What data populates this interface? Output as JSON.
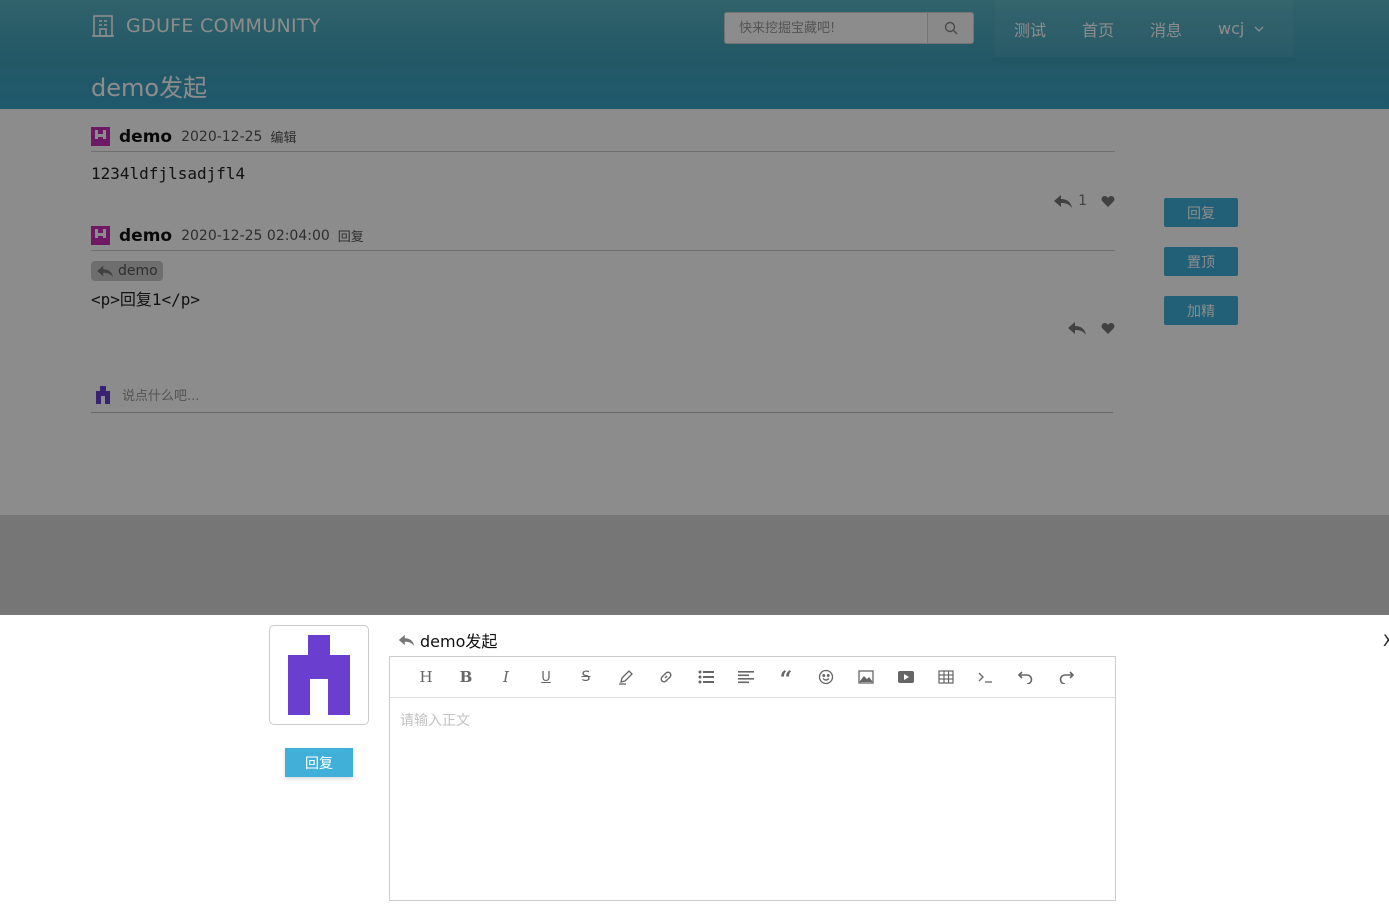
{
  "header": {
    "brand": "GDUFE COMMUNITY",
    "search_placeholder": "快来挖掘宝藏吧!",
    "nav": [
      "测试",
      "首页",
      "消息"
    ],
    "user": "wcj",
    "page_title": "demo发起"
  },
  "posts": [
    {
      "author": "demo",
      "date": "2020-12-25",
      "action": "编辑",
      "body": "1234ldfjlsadjfl4",
      "reply_count": "1"
    },
    {
      "author": "demo",
      "date": "2020-12-25 02:04:00",
      "action": "回复",
      "quote": "demo",
      "body": "<p>回复1</p>"
    }
  ],
  "side_buttons": [
    "回复",
    "置顶",
    "加精"
  ],
  "comment_prompt": "说点什么吧...",
  "reply_panel": {
    "button": "回复",
    "target": "demo发起",
    "close": "X",
    "editor_placeholder": "请输入正文",
    "toolbar": [
      "heading-icon",
      "bold-icon",
      "italic-icon",
      "underline-icon",
      "strikethrough-icon",
      "pen-icon",
      "link-icon",
      "bullet-list-icon",
      "align-icon",
      "quote-icon",
      "emoji-icon",
      "image-icon",
      "video-icon",
      "table-icon",
      "code-icon",
      "undo-icon",
      "redo-icon"
    ]
  },
  "colors": {
    "header_start": "#58b4c2",
    "header_end": "#3aa2c6",
    "accent": "#3dafd8",
    "avatar_purple": "#6a3fd0"
  }
}
